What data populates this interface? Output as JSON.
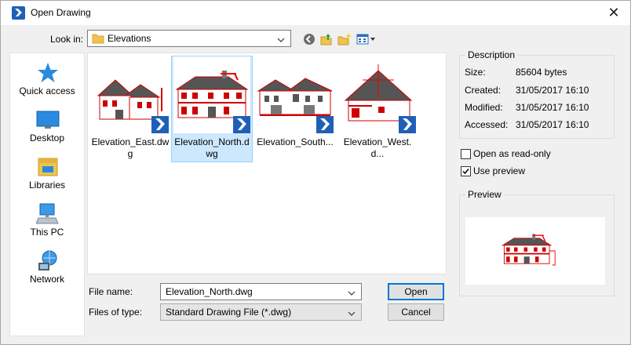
{
  "window": {
    "title": "Open Drawing",
    "close_glyph": "✕"
  },
  "look_in": {
    "label": "Look in:",
    "value": "Elevations"
  },
  "toolbar": {
    "icons": [
      "back-icon",
      "up-folder-icon",
      "new-folder-icon",
      "view-menu-icon"
    ]
  },
  "places": [
    {
      "label": "Quick access",
      "icon": "star-icon"
    },
    {
      "label": "Desktop",
      "icon": "desktop-icon"
    },
    {
      "label": "Libraries",
      "icon": "libraries-icon"
    },
    {
      "label": "This PC",
      "icon": "computer-icon"
    },
    {
      "label": "Network",
      "icon": "network-icon"
    }
  ],
  "files": [
    {
      "label": "Elevation_East.dwg",
      "selected": false
    },
    {
      "label": "Elevation_North.dwg",
      "selected": true
    },
    {
      "label": "Elevation_South...",
      "selected": false
    },
    {
      "label": "Elevation_West.d...",
      "selected": false
    }
  ],
  "file_name": {
    "label": "File name:",
    "value": "Elevation_North.dwg"
  },
  "file_type": {
    "label": "Files of type:",
    "value": "Standard Drawing File (*.dwg)"
  },
  "buttons": {
    "open": "Open",
    "cancel": "Cancel"
  },
  "description": {
    "title": "Description",
    "size_label": "Size:",
    "size": "85604 bytes",
    "created_label": "Created:",
    "created": "31/05/2017 16:10",
    "modified_label": "Modified:",
    "modified": "31/05/2017 16:10",
    "accessed_label": "Accessed:",
    "accessed": "31/05/2017 16:10"
  },
  "options": {
    "read_only": {
      "label": "Open as read-only",
      "checked": false
    },
    "use_preview": {
      "label": "Use preview",
      "checked": true
    }
  },
  "preview": {
    "title": "Preview"
  },
  "colors": {
    "accent": "#0078d7",
    "selection": "#cce8ff",
    "app_blue": "#1f5fb8",
    "drawing_red": "#e00000"
  }
}
